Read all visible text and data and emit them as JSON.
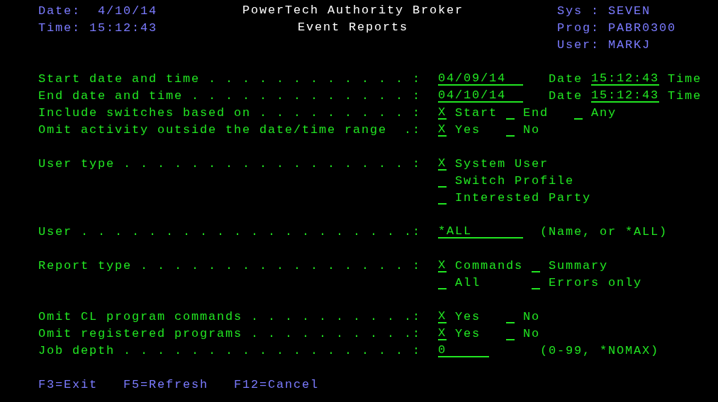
{
  "header": {
    "left": [
      {
        "label": "Date:",
        "value": "4/10/14"
      },
      {
        "label": "Time:",
        "value": "15:12:43"
      }
    ],
    "title": "PowerTech Authority Broker",
    "subtitle": "Event Reports",
    "right": [
      {
        "label": "Sys :",
        "value": "SEVEN"
      },
      {
        "label": "Prog:",
        "value": "PABR0300"
      },
      {
        "label": "User:",
        "value": "MARKJ"
      }
    ]
  },
  "sections": [
    [
      {
        "label": "Start date and time . . . . . . . . . . . . :",
        "rows": [
          [
            {
              "kind": "date-field",
              "value": "04/09/14"
            },
            {
              "kind": "text",
              "text": "Date"
            },
            {
              "kind": "time-field",
              "value": "15:12:43"
            },
            {
              "kind": "text",
              "text": "Time"
            }
          ]
        ]
      },
      {
        "label": "End date and time . . . . . . . . . . . . . :",
        "rows": [
          [
            {
              "kind": "date-field",
              "value": "04/10/14"
            },
            {
              "kind": "text",
              "text": "Date"
            },
            {
              "kind": "time-field",
              "value": "15:12:43"
            },
            {
              "kind": "text",
              "text": "Time"
            }
          ]
        ]
      },
      {
        "label": "Include switches based on . . . . . . . . . :",
        "rows": [
          [
            {
              "kind": "option",
              "value": "X",
              "label": "Start"
            },
            {
              "kind": "option",
              "label": "End"
            },
            {
              "kind": "option",
              "label": "Any"
            }
          ]
        ]
      },
      {
        "label": "Omit activity outside the date/time range  .:",
        "rows": [
          [
            {
              "kind": "option",
              "value": "X",
              "label": "Yes"
            },
            {
              "kind": "option",
              "label": "No"
            }
          ]
        ]
      }
    ],
    [
      {
        "label": "User type . . . . . . . . . . . . . . . . . :",
        "rows": [
          [
            {
              "kind": "option",
              "value": "X",
              "label": "System User"
            }
          ],
          [
            {
              "kind": "option",
              "label": "Switch Profile"
            }
          ],
          [
            {
              "kind": "option",
              "label": "Interested Party"
            }
          ]
        ]
      }
    ],
    [
      {
        "label": "User . . . . . . . . . . . . . . . . . . . .:",
        "rows": [
          [
            {
              "kind": "name-field",
              "value": "*ALL"
            },
            {
              "kind": "hint",
              "text": "(Name, or *ALL)"
            }
          ]
        ]
      }
    ],
    [
      {
        "label": "Report type . . . . . . . . . . . . . . . . :",
        "rows": [
          [
            {
              "kind": "option",
              "value": "X",
              "label": "Commands"
            },
            {
              "kind": "option",
              "label": "Summary"
            }
          ],
          [
            {
              "kind": "option",
              "label": "All"
            },
            {
              "kind": "option",
              "label": "Errors only"
            }
          ]
        ]
      }
    ],
    [
      {
        "label": "Omit CL program commands . . . . . . . . . .:",
        "rows": [
          [
            {
              "kind": "option",
              "value": "X",
              "label": "Yes"
            },
            {
              "kind": "option",
              "label": "No"
            }
          ]
        ]
      },
      {
        "label": "Omit registered programs . . . . . . . . . .:",
        "rows": [
          [
            {
              "kind": "option",
              "value": "X",
              "label": "Yes"
            },
            {
              "kind": "option",
              "label": "No"
            }
          ]
        ]
      },
      {
        "label": "Job depth . . . . . . . . . . . . . . . . . :",
        "rows": [
          [
            {
              "kind": "number-field",
              "value": "0"
            },
            {
              "kind": "hint",
              "text": "(0-99, *NOMAX)"
            }
          ]
        ]
      }
    ]
  ],
  "function_keys": [
    "F3=Exit",
    "F5=Refresh",
    "F12=Cancel"
  ]
}
